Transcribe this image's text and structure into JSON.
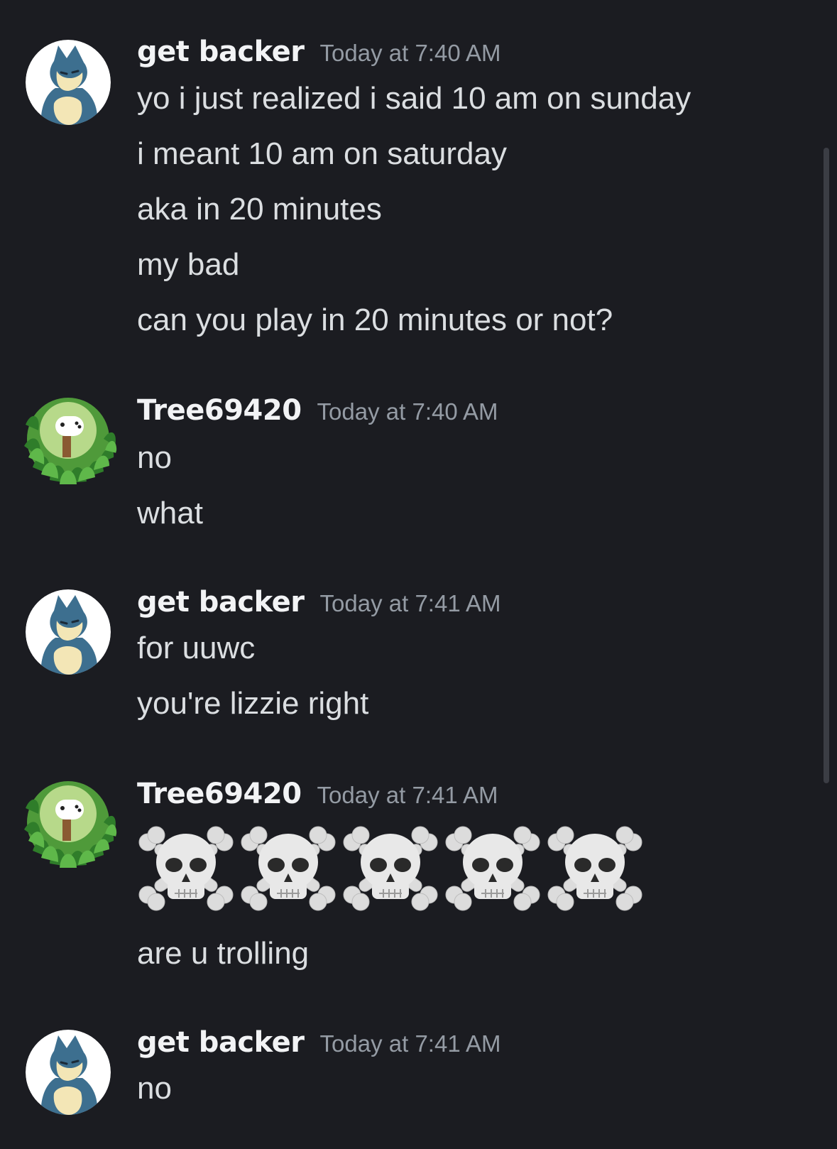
{
  "colors": {
    "background": "#1b1c21",
    "username": "#f2f3f5",
    "timestamp": "#949ba4",
    "message_text": "#dbdee1",
    "scrollbar": "#3b3d44"
  },
  "messages": [
    {
      "avatar_icon": "munchlax-avatar-icon",
      "username": "get backer",
      "timestamp": "Today at 7:40 AM",
      "lines": [
        "yo i just realized i said 10 am on sunday",
        "i meant 10 am on saturday",
        "aka in 20 minutes",
        "my bad",
        "can you play in 20 minutes or not?"
      ]
    },
    {
      "avatar_icon": "controller-in-grass-avatar-icon",
      "username": "Tree69420",
      "timestamp": "Today at 7:40 AM",
      "lines": [
        "no",
        "what"
      ]
    },
    {
      "avatar_icon": "munchlax-avatar-icon",
      "username": "get backer",
      "timestamp": "Today at 7:41 AM",
      "lines": [
        "for uuwc",
        "you're lizzie right"
      ]
    },
    {
      "avatar_icon": "controller-in-grass-avatar-icon",
      "username": "Tree69420",
      "timestamp": "Today at 7:41 AM",
      "emoji": [
        "skull-and-crossbones-icon",
        "skull-and-crossbones-icon",
        "skull-and-crossbones-icon",
        "skull-and-crossbones-icon",
        "skull-and-crossbones-icon"
      ],
      "lines": [
        "are u trolling"
      ]
    },
    {
      "avatar_icon": "munchlax-avatar-icon",
      "username": "get backer",
      "timestamp": "Today at 7:41 AM",
      "lines": [
        "no"
      ]
    }
  ]
}
